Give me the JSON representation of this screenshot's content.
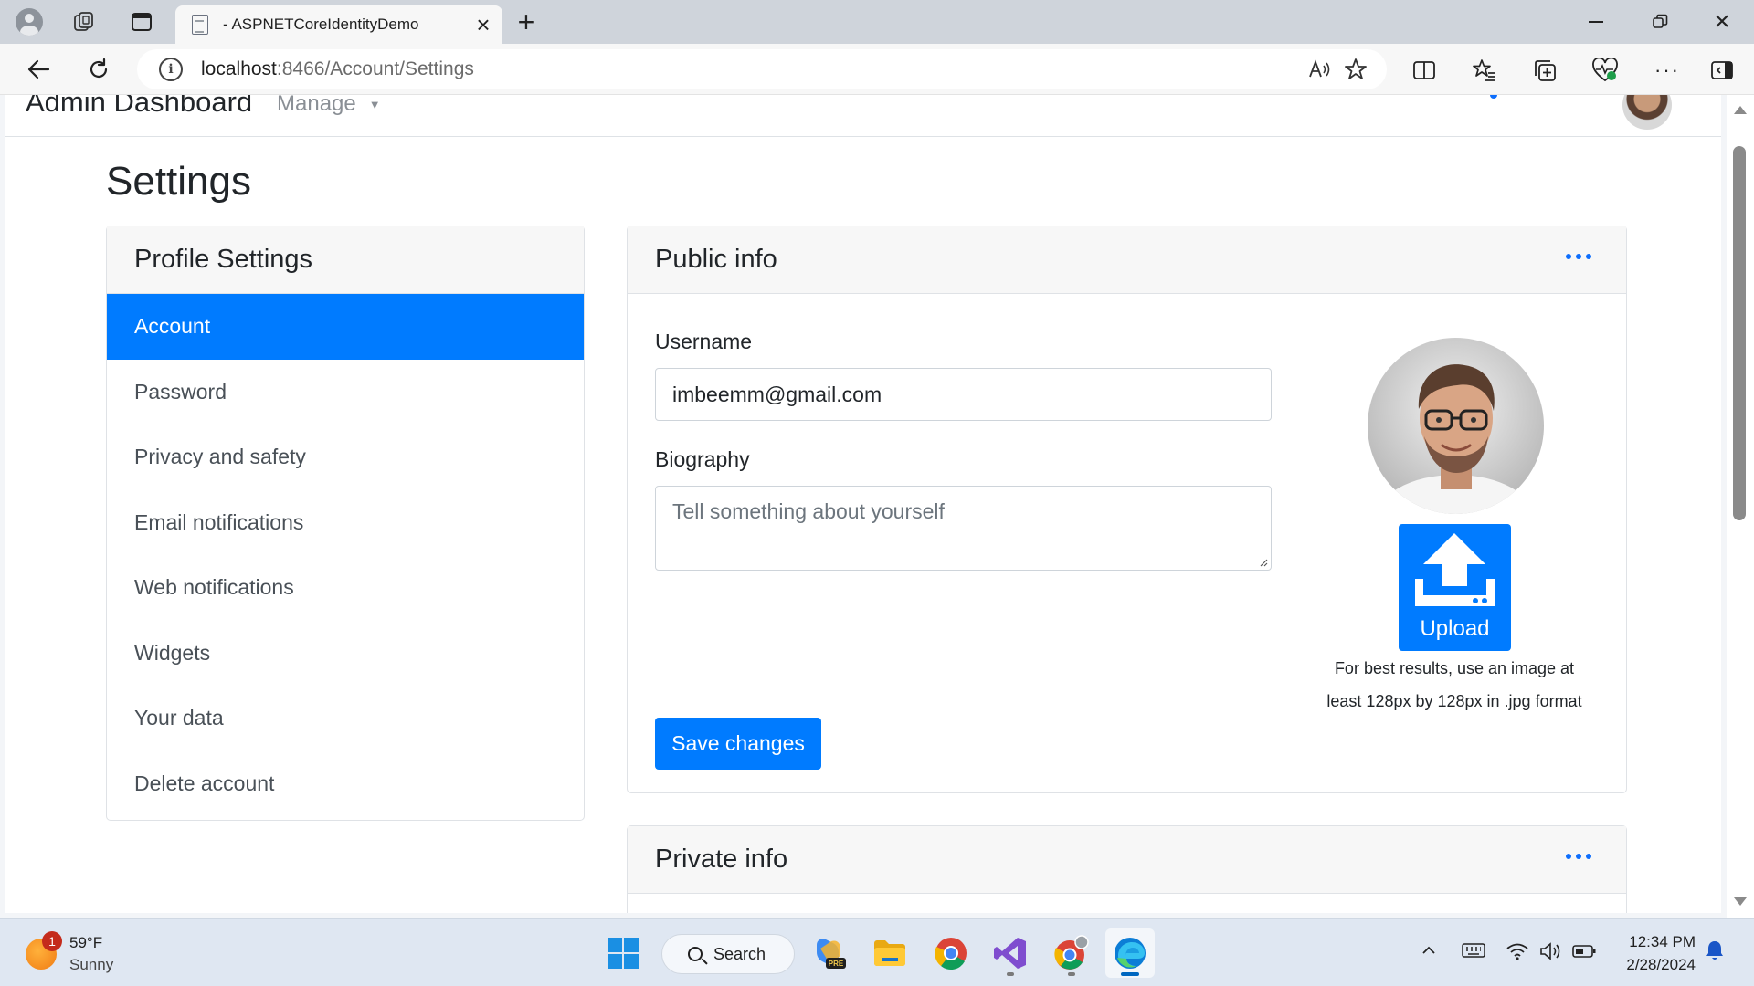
{
  "browser": {
    "tab_title": "- ASPNETCoreIdentityDemo",
    "url_host": "localhost",
    "url_path": ":8466/Account/Settings"
  },
  "site": {
    "brand": "Admin Dashboard",
    "manage": "Manage"
  },
  "page": {
    "title": "Settings"
  },
  "profile_settings": {
    "header": "Profile Settings",
    "items": [
      {
        "label": "Account",
        "active": true
      },
      {
        "label": "Password"
      },
      {
        "label": "Privacy and safety"
      },
      {
        "label": "Email notifications"
      },
      {
        "label": "Web notifications"
      },
      {
        "label": "Widgets"
      },
      {
        "label": "Your data"
      },
      {
        "label": "Delete account"
      }
    ]
  },
  "public_info": {
    "header": "Public info",
    "username_label": "Username",
    "username_value": "imbeemm@gmail.com",
    "biography_label": "Biography",
    "biography_placeholder": "Tell something about yourself",
    "upload_label": "Upload",
    "hint_line1": "For best results, use an image at",
    "hint_line2": "least 128px by 128px in .jpg format",
    "save_label": "Save changes"
  },
  "private_info": {
    "header": "Private info"
  },
  "taskbar": {
    "temperature": "59°F",
    "condition": "Sunny",
    "weather_badge": "1",
    "search_label": "Search",
    "time": "12:34 PM",
    "date": "2/28/2024"
  },
  "colors": {
    "accent": "#007bff",
    "link_blue": "#0d6efd",
    "tabstrip": "#cfd4db",
    "taskbar": "#dfe7f2"
  }
}
